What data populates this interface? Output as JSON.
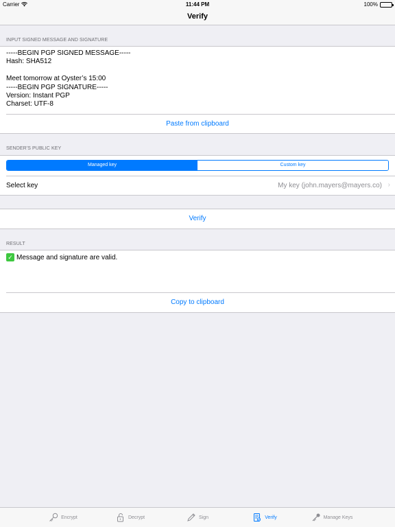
{
  "status_bar": {
    "carrier": "Carrier",
    "time": "11:44 PM",
    "battery_percent": "100%"
  },
  "nav": {
    "title": "Verify"
  },
  "input_section": {
    "header": "INPUT SIGNED MESSAGE AND SIGNATURE",
    "message": "-----BEGIN PGP SIGNED MESSAGE-----\nHash: SHA512\n\nMeet tomorrow at Oyster’s 15:00\n-----BEGIN PGP SIGNATURE-----\nVersion: Instant PGP\nCharset: UTF-8",
    "paste_label": "Paste from clipboard"
  },
  "key_section": {
    "header": "SENDER'S PUBLIC KEY",
    "segments": [
      "Managed key",
      "Custom key"
    ],
    "selected_segment": 0,
    "select_label": "Select key",
    "select_value": "My key (john.mayers@mayers.co)"
  },
  "verify_button": {
    "label": "Verify"
  },
  "result_section": {
    "header": "RESULT",
    "check_glyph": "✓",
    "result_text": "Message and signature are valid.",
    "copy_label": "Copy to clipboard"
  },
  "tab_bar": {
    "tabs": [
      {
        "label": "Encrypt",
        "icon": "key-icon"
      },
      {
        "label": "Decrypt",
        "icon": "padlock-open-icon"
      },
      {
        "label": "Sign",
        "icon": "pencil-icon"
      },
      {
        "label": "Verify",
        "icon": "document-verify-icon"
      },
      {
        "label": "Manage Keys",
        "icon": "keys-icon"
      }
    ],
    "active_index": 3
  },
  "colors": {
    "accent": "#007aff",
    "background": "#efeff4",
    "secondary_text": "#8e8e93",
    "check_green": "#3ec840"
  }
}
